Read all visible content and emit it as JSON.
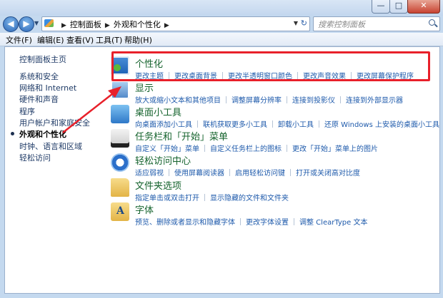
{
  "window": {
    "controls": {
      "minimize": "—",
      "maximize": "□",
      "close": "✕"
    }
  },
  "nav": {
    "back_icon": "back-arrow-icon",
    "forward_icon": "forward-arrow-icon",
    "breadcrumbs": [
      "控制面板",
      "外观和个性化"
    ],
    "search_placeholder": "搜索控制面板"
  },
  "menu": [
    "文件(F)",
    "编辑(E)",
    "查看(V)",
    "工具(T)",
    "帮助(H)"
  ],
  "sidebar": {
    "items": [
      {
        "label": "控制面板主页"
      },
      {
        "label": "系统和安全"
      },
      {
        "label": "网络和 Internet"
      },
      {
        "label": "硬件和声音"
      },
      {
        "label": "程序"
      },
      {
        "label": "用户帐户和家庭安全"
      },
      {
        "label": "外观和个性化",
        "active": true
      },
      {
        "label": "时钟、语言和区域"
      },
      {
        "label": "轻松访问"
      }
    ]
  },
  "categories": [
    {
      "title": "个性化",
      "icon": "personalization-icon",
      "links": [
        "更改主题",
        "更改桌面背景",
        "更改半透明窗口颜色",
        "更改声音效果",
        "更改屏幕保护程序"
      ]
    },
    {
      "title": "显示",
      "icon": "display-icon",
      "links": [
        "放大或缩小文本和其他项目",
        "调整屏幕分辨率",
        "连接到投影仪",
        "连接到外部显示器"
      ]
    },
    {
      "title": "桌面小工具",
      "icon": "desktop-gadgets-icon",
      "links": [
        "向桌面添加小工具",
        "联机获取更多小工具",
        "卸载小工具",
        "还原 Windows 上安装的桌面小工具"
      ]
    },
    {
      "title": "任务栏和「开始」菜单",
      "icon": "taskbar-icon",
      "links": [
        "自定义「开始」菜单",
        "自定义任务栏上的图标",
        "更改「开始」菜单上的图片"
      ]
    },
    {
      "title": "轻松访问中心",
      "icon": "ease-of-access-icon",
      "links": [
        "适应弱视",
        "使用屏幕阅读器",
        "启用轻松访问键",
        "打开或关闭高对比度"
      ]
    },
    {
      "title": "文件夹选项",
      "icon": "folder-options-icon",
      "links": [
        "指定单击或双击打开",
        "显示隐藏的文件和文件夹"
      ]
    },
    {
      "title": "字体",
      "icon": "fonts-icon",
      "links": [
        "预览、删除或者显示和隐藏字体",
        "更改字体设置",
        "调整 ClearType 文本"
      ]
    }
  ],
  "colors": {
    "highlight": "#e8202a",
    "link": "#1e5aab",
    "title": "#15632d"
  }
}
